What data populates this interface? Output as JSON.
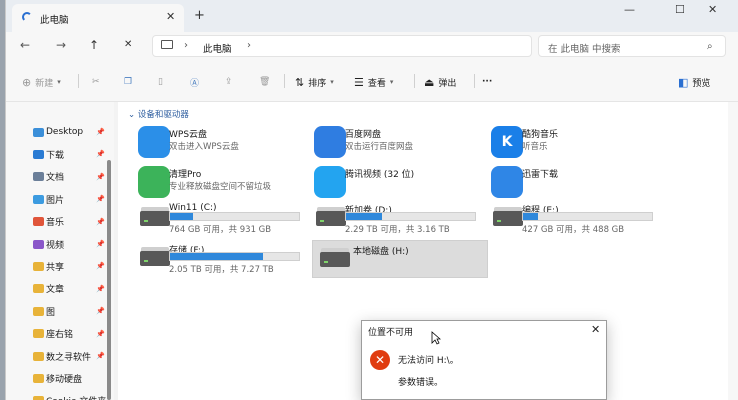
{
  "tab": {
    "title": "此电脑",
    "close": "✕",
    "new": "+"
  },
  "window_controls": {
    "minimize": "—",
    "maximize": "☐",
    "close": "✕"
  },
  "nav": {
    "back": "←",
    "forward": "→",
    "up": "↑",
    "cancel": "✕",
    "sep": "›",
    "location": "此电脑",
    "search_placeholder": "在 此电脑 中搜索",
    "search_icon": "⌕"
  },
  "toolbar": {
    "new_label": "新建",
    "sort_label": "排序",
    "view_label": "查看",
    "eject_label": "弹出",
    "more": "···",
    "preview_label": "预览"
  },
  "sidebar": {
    "items": [
      {
        "label": "Desktop",
        "color": "#3b8fd9"
      },
      {
        "label": "下载",
        "color": "#2a7bd3"
      },
      {
        "label": "文档",
        "color": "#6b7f99"
      },
      {
        "label": "图片",
        "color": "#3c9be0"
      },
      {
        "label": "音乐",
        "color": "#e0553a"
      },
      {
        "label": "视频",
        "color": "#8a57c9"
      },
      {
        "label": "共享",
        "color": "#e8b339"
      },
      {
        "label": "文章",
        "color": "#e8b339"
      },
      {
        "label": "图",
        "color": "#e8b339"
      },
      {
        "label": "座右铭",
        "color": "#e8b339"
      },
      {
        "label": "数之寻软件",
        "color": "#e8b339"
      },
      {
        "label": "移动硬盘",
        "color": "#e8b339"
      },
      {
        "label": "Cookie 文件夹",
        "color": "#e8b339"
      }
    ]
  },
  "content": {
    "group_header": "设备和驱动器",
    "apps": [
      {
        "name": "WPS云盘",
        "sub": "双击进入WPS云盘",
        "icon": "wps-cloud-icon",
        "color": "#2b8fe8"
      },
      {
        "name": "百度网盘",
        "sub": "双击运行百度网盘",
        "icon": "baidu-netdisk-icon",
        "color": "#2f7de1"
      },
      {
        "name": "酷狗音乐",
        "sub": "听音乐",
        "icon": "kugou-icon",
        "color": "#1a7fe8",
        "glyph": "K"
      },
      {
        "name": "清理Pro",
        "sub": "专业释放磁盘空间不留垃圾",
        "icon": "cleanpro-icon",
        "color": "#3cb35a"
      },
      {
        "name": "腾讯视频 (32 位)",
        "sub": "",
        "icon": "tencent-video-icon",
        "color": "#23a4f0"
      },
      {
        "name": "迅雷下载",
        "sub": "",
        "icon": "thunder-icon",
        "color": "#2f86e6"
      }
    ],
    "drives": [
      {
        "name": "Win11 (C:)",
        "size": "764 GB 可用，共 931 GB",
        "used": 0.18,
        "bar": true
      },
      {
        "name": "新加卷 (D:)",
        "size": "2.29 TB 可用，共 3.16 TB",
        "used": 0.28,
        "bar": true
      },
      {
        "name": "编程 (E:)",
        "size": "427 GB 可用，共 488 GB",
        "used": 0.12,
        "bar": true
      },
      {
        "name": "存储 (F:)",
        "size": "2.05 TB 可用，共 7.27 TB",
        "used": 0.72,
        "bar": true
      },
      {
        "name": "本地磁盘 (H:)",
        "size": "",
        "used": 0,
        "bar": false,
        "selected": true
      }
    ]
  },
  "dialog": {
    "title": "位置不可用",
    "close": "✕",
    "error_glyph": "✕",
    "message": "无法访问 H:\\。",
    "detail": "参数错误。"
  },
  "colors": {
    "accent": "#2f88db",
    "error": "#e03c10",
    "group": "#2d5d9f"
  }
}
